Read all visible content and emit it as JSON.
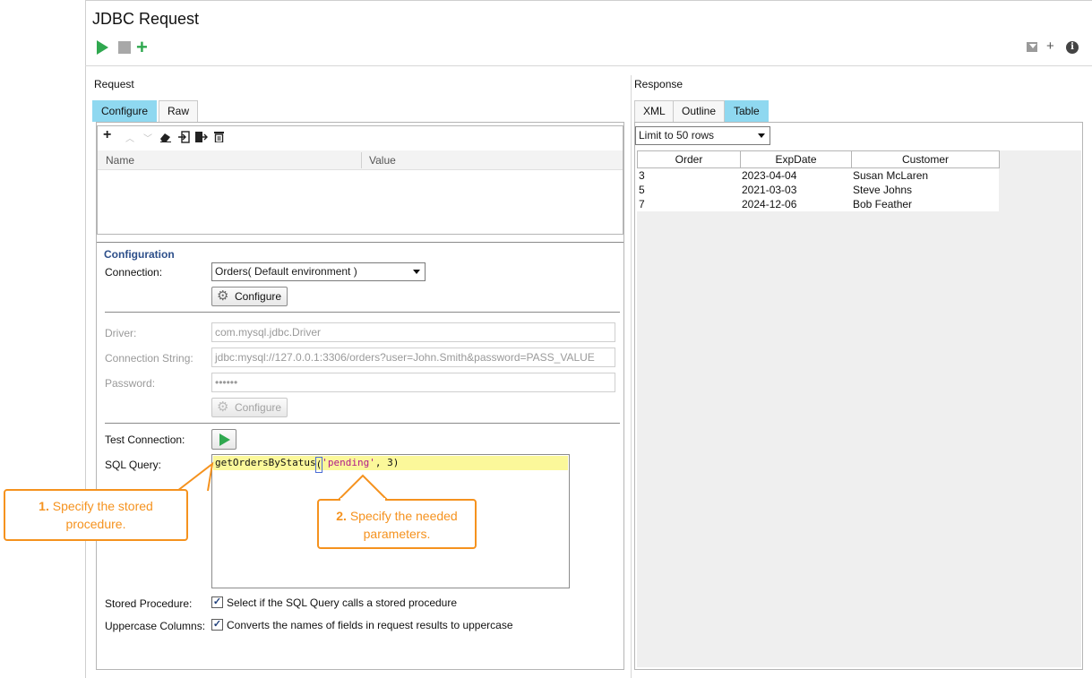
{
  "window": {
    "title": "JDBC Request"
  },
  "toolbar": {
    "run_icon": "play-icon",
    "stop_icon": "stop-icon",
    "add_icon": "plus-icon",
    "add_label": "+",
    "right_plus_label": "+",
    "info_label": "i"
  },
  "request": {
    "label": "Request",
    "tabs": [
      {
        "label": "Configure",
        "active": true
      },
      {
        "label": "Raw",
        "active": false
      }
    ],
    "params_table": {
      "columns": [
        "Name",
        "Value"
      ]
    },
    "configuration": {
      "heading": "Configuration",
      "connection_label": "Connection:",
      "connection_value": "Orders( Default environment )",
      "configure_button": "Configure",
      "driver_label": "Driver:",
      "driver_value": "com.mysql.jdbc.Driver",
      "connection_string_label": "Connection String:",
      "connection_string_value": "jdbc:mysql://127.0.0.1:3306/orders?user=John.Smith&password=PASS_VALUE",
      "password_label": "Password:",
      "password_value": "••••••",
      "configure_button_disabled": "Configure",
      "test_connection_label": "Test Connection:",
      "sql_query_label": "SQL Query:",
      "sql_query": {
        "proc": "getOrdersByStatus",
        "open": "(",
        "arg_string": "'pending'",
        "rest": ", 3)"
      },
      "stored_procedure_label": "Stored Procedure:",
      "stored_procedure_checked": true,
      "stored_procedure_text": "Select if the SQL Query calls a stored procedure",
      "uppercase_label": "Uppercase Columns:",
      "uppercase_checked": true,
      "uppercase_text": "Converts the names of fields in request results to uppercase"
    }
  },
  "response": {
    "label": "Response",
    "tabs": [
      {
        "label": "XML",
        "active": false
      },
      {
        "label": "Outline",
        "active": false
      },
      {
        "label": "Table",
        "active": true
      }
    ],
    "limit_select": "Limit to 50 rows",
    "table": {
      "columns": [
        "Order",
        "ExpDate",
        "Customer"
      ],
      "rows": [
        [
          "3",
          "2023-04-04",
          "Susan McLaren"
        ],
        [
          "5",
          "2021-03-03",
          "Steve Johns"
        ],
        [
          "7",
          "2024-12-06",
          "Bob Feather"
        ]
      ]
    }
  },
  "callouts": {
    "one": {
      "num": "1.",
      "line1": " Specify the stored",
      "line2": "procedure."
    },
    "two": {
      "num": "2.",
      "line1": " Specify the needed",
      "line2": "parameters."
    }
  },
  "colors": {
    "accent_tab": "#8fd8f0",
    "run_green": "#2fa84f",
    "callout_orange": "#f5921e",
    "config_heading": "#2d4f8a"
  }
}
